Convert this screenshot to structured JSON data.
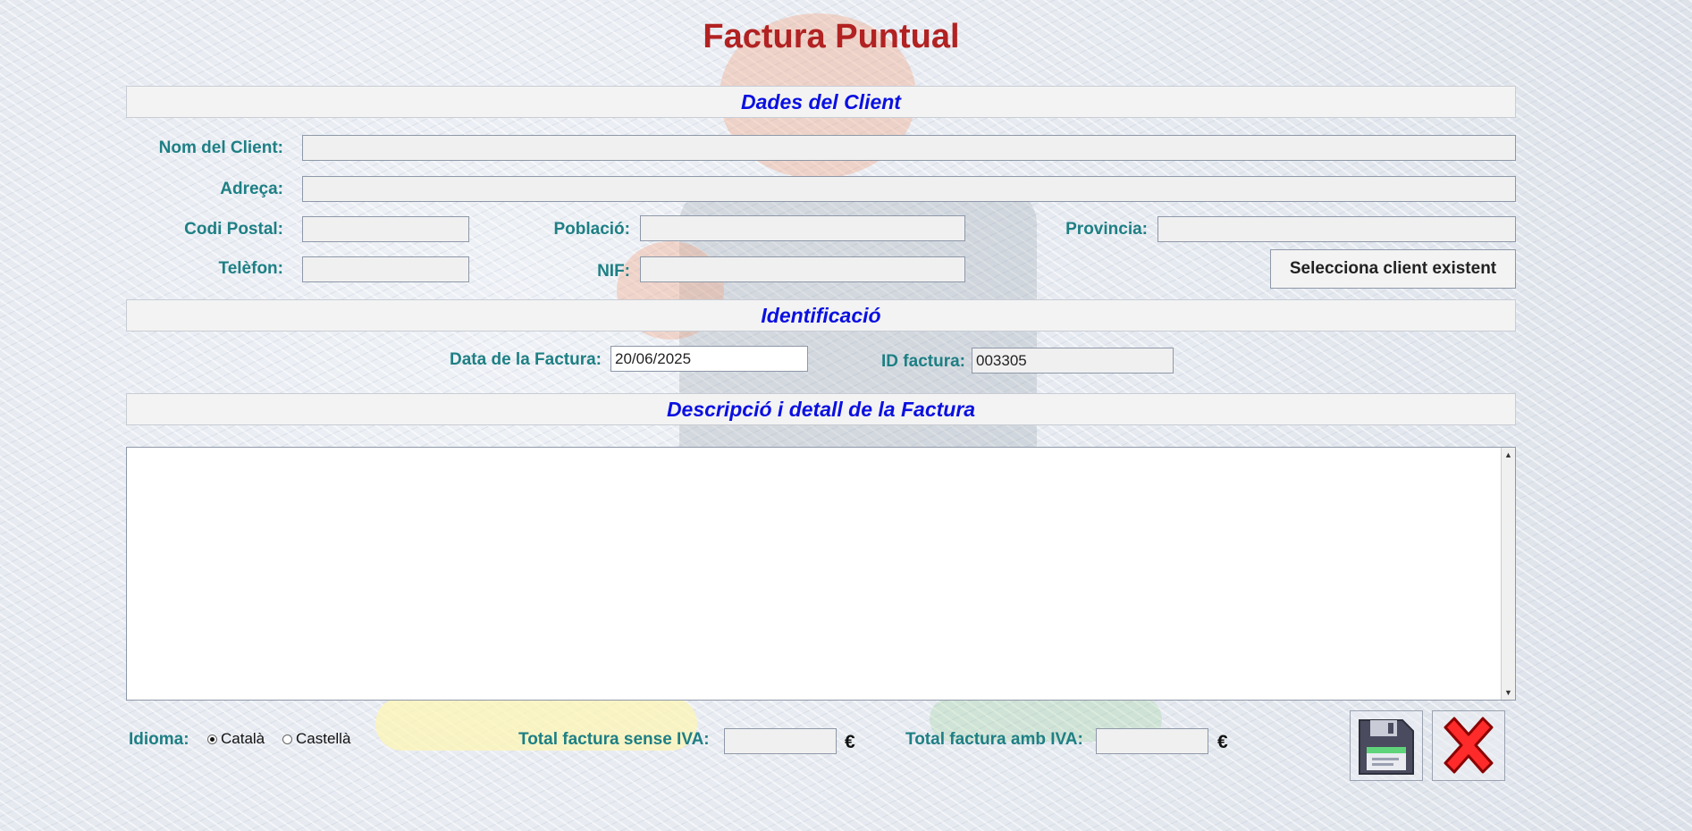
{
  "window": {
    "title": "Factura Puntual"
  },
  "sections": {
    "client": "Dades del Client",
    "identification": "Identificació",
    "description": "Descripció i detall de la Factura"
  },
  "client": {
    "name_label": "Nom del Client:",
    "name_value": "",
    "address_label": "Adreça:",
    "address_value": "",
    "postal_label": "Codi Postal:",
    "postal_value": "",
    "town_label": "Població:",
    "town_value": "",
    "province_label": "Provincia:",
    "province_value": "",
    "phone_label": "Telèfon:",
    "phone_value": "",
    "nif_label": "NIF:",
    "nif_value": "",
    "select_button": "Selecciona client existent"
  },
  "identification": {
    "date_label": "Data de la Factura:",
    "date_value": "20/06/2025",
    "id_label": "ID factura:",
    "id_value": "003305"
  },
  "description": {
    "text": ""
  },
  "footer": {
    "language_label": "Idioma:",
    "languages": [
      {
        "label": "Català",
        "selected": true
      },
      {
        "label": "Castellà",
        "selected": false
      }
    ],
    "total_no_vat_label": "Total factura sense IVA:",
    "total_no_vat_value": "",
    "total_vat_label": "Total factura amb IVA:",
    "total_vat_value": "",
    "currency": "€"
  },
  "icons": {
    "save": "floppy-disk-icon",
    "close": "red-x-icon"
  },
  "colors": {
    "title": "#b22222",
    "section_heading": "#0a10e0",
    "label": "#1d7f84"
  }
}
